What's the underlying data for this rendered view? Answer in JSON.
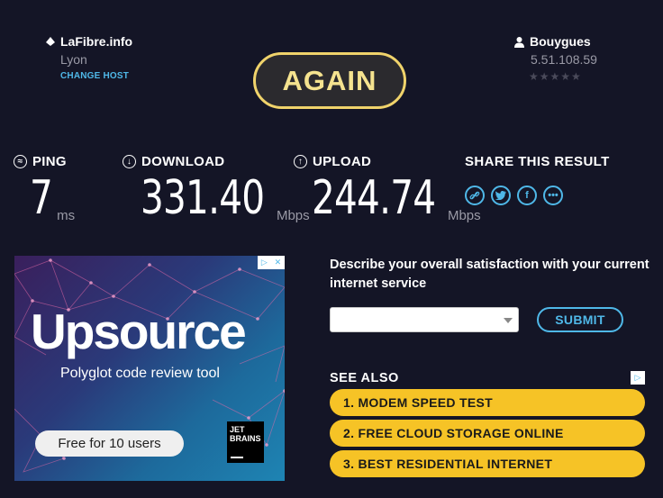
{
  "host": {
    "icon": "location-icon",
    "name": "LaFibre.info",
    "city": "Lyon",
    "change_label": "CHANGE HOST"
  },
  "isp": {
    "icon": "user-icon",
    "name": "Bouygues",
    "ip": "5.51.108.59",
    "stars": "★★★★★",
    "rating": 0
  },
  "again_label": "AGAIN",
  "metrics": {
    "ping": {
      "label": "PING",
      "value": "7",
      "unit": "ms"
    },
    "download": {
      "label": "DOWNLOAD",
      "value": "331.40",
      "unit": "Mbps"
    },
    "upload": {
      "label": "UPLOAD",
      "value": "244.74",
      "unit": "Mbps"
    }
  },
  "share": {
    "label": "SHARE THIS RESULT",
    "icons": [
      "link-icon",
      "twitter-icon",
      "facebook-icon",
      "more-icon"
    ]
  },
  "ad": {
    "title": "Upsource",
    "subtitle": "Polyglot code review tool",
    "cta": "Free for 10 users",
    "logo_line1": "JET",
    "logo_line2": "BRAINS"
  },
  "survey": {
    "question": "Describe your overall satisfaction with your current internet service",
    "select_value": "",
    "submit_label": "SUBMIT"
  },
  "see_also": {
    "heading": "SEE ALSO",
    "links": [
      "1.  MODEM SPEED TEST",
      "2.  FREE CLOUD STORAGE ONLINE",
      "3.  BEST RESIDENTIAL INTERNET"
    ]
  },
  "colors": {
    "background": "#141526",
    "accent": "#4fb8e8",
    "again_border": "#f0d36b",
    "link_pill": "#f6c326"
  }
}
